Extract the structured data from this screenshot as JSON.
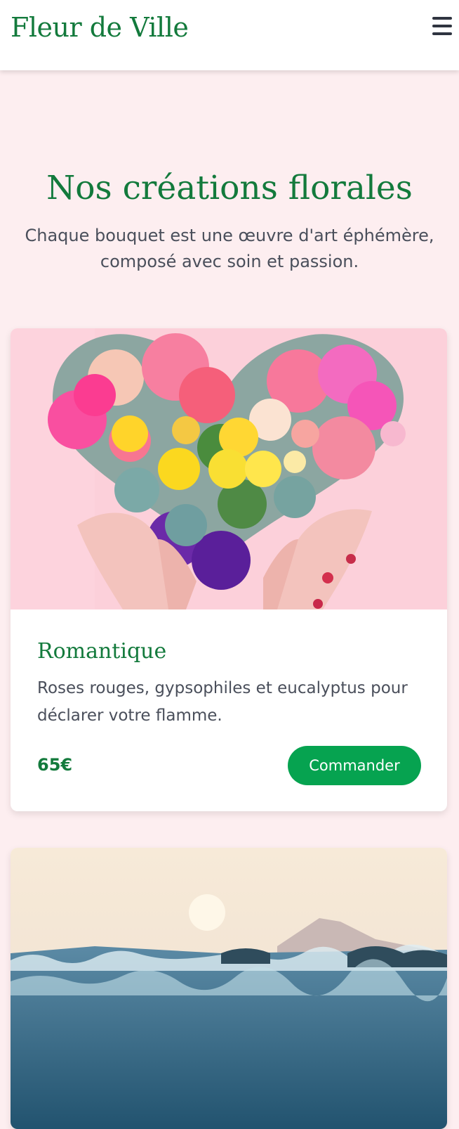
{
  "header": {
    "brand": "Fleur de Ville",
    "menu_icon": "hamburger-menu-icon"
  },
  "hero": {
    "title": "Nos créations florales",
    "subtitle": "Chaque bouquet est une œuvre d'art éphémère, composé avec soin et passion."
  },
  "products": [
    {
      "title": "Romantique",
      "description": "Roses rouges, gypsophiles et eucalyptus pour déclarer votre flamme.",
      "price": "65€",
      "button": "Commander",
      "image": "heart-shaped-bouquet-in-hands"
    },
    {
      "image": "sea-waves-at-sunrise"
    }
  ],
  "colors": {
    "brand_green": "#137a3c",
    "button_green": "#06a350",
    "page_background": "#fdeef0",
    "text_gray": "#4a4f5b"
  }
}
